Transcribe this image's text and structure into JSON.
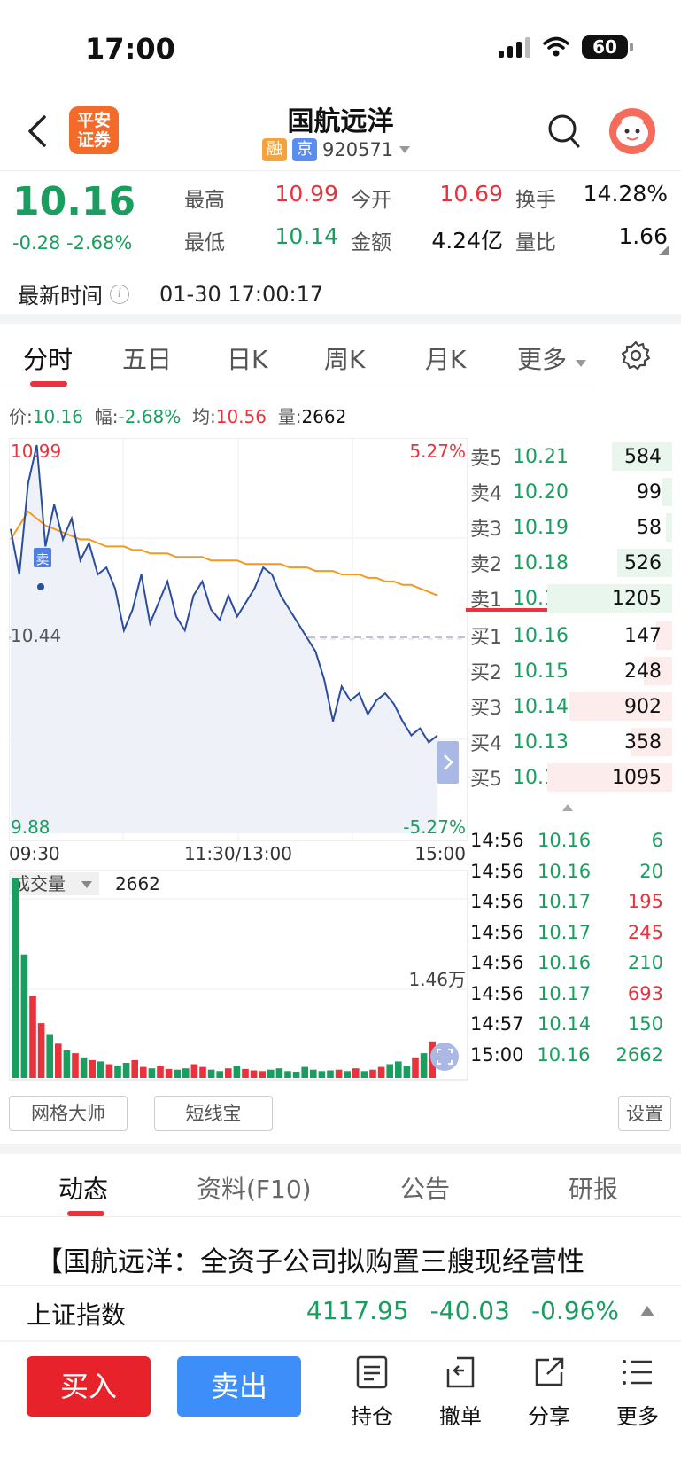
{
  "status": {
    "time": "17:00",
    "battery": "60"
  },
  "header": {
    "logo": "平安证券",
    "title": "国航远洋",
    "tag_rong": "融",
    "tag_jing": "京",
    "code": "920571"
  },
  "quote": {
    "price": "10.16",
    "change": "-0.28",
    "change_pct": "-2.68%",
    "high_label": "最高",
    "high": "10.99",
    "open_label": "今开",
    "open": "10.69",
    "turnover_label": "换手",
    "turnover": "14.28%",
    "low_label": "最低",
    "low": "10.14",
    "amount_label": "金额",
    "amount": "4.24亿",
    "vol_ratio_label": "量比",
    "vol_ratio": "1.66",
    "latest_label": "最新时间",
    "latest_time": "01-30 17:00:17"
  },
  "ktabs": [
    "分时",
    "五日",
    "日K",
    "周K",
    "月K",
    "更多"
  ],
  "pricebar": {
    "price_label": "价:",
    "price": "10.16",
    "range_label": "幅:",
    "range": "-2.68%",
    "avg_label": "均:",
    "avg": "10.56",
    "vol_label": "量:",
    "vol": "2662"
  },
  "chart_data": {
    "type": "line",
    "x_ticks": [
      "09:30",
      "11:30/13:00",
      "15:00"
    ],
    "ylim": [
      9.88,
      10.99
    ],
    "y_ticks": [
      "10.99",
      "10.44",
      "9.88"
    ],
    "right_ticks": [
      "5.27%",
      "-5.27%"
    ],
    "prev_close": 10.44,
    "sell_marker": "卖",
    "series": [
      {
        "values": [
          10.75,
          10.62,
          10.88,
          10.99,
          10.7,
          10.82,
          10.72,
          10.78,
          10.66,
          10.71,
          10.62,
          10.64,
          10.58,
          10.46,
          10.52,
          10.62,
          10.48,
          10.54,
          10.6,
          10.5,
          10.46,
          10.56,
          10.6,
          10.52,
          10.49,
          10.56,
          10.5,
          10.54,
          10.58,
          10.64,
          10.62,
          10.56,
          10.52,
          10.48,
          10.44,
          10.4,
          10.32,
          10.2,
          10.3,
          10.26,
          10.28,
          10.22,
          10.26,
          10.28,
          10.25,
          10.2,
          10.16,
          10.18,
          10.14,
          10.16
        ]
      },
      {
        "values": [
          10.72,
          10.76,
          10.8,
          10.78,
          10.76,
          10.75,
          10.74,
          10.73,
          10.72,
          10.72,
          10.71,
          10.7,
          10.7,
          10.7,
          10.69,
          10.69,
          10.68,
          10.68,
          10.68,
          10.67,
          10.67,
          10.67,
          10.67,
          10.66,
          10.66,
          10.66,
          10.66,
          10.65,
          10.65,
          10.65,
          10.65,
          10.65,
          10.64,
          10.64,
          10.64,
          10.63,
          10.63,
          10.63,
          10.62,
          10.62,
          10.62,
          10.61,
          10.61,
          10.6,
          10.6,
          10.59,
          10.59,
          10.58,
          10.57,
          10.56
        ]
      }
    ],
    "volume_label": "成交量",
    "volume_value": "2662",
    "volume_tick": "1.46万",
    "volume": [
      14600,
      9000,
      6000,
      4000,
      3200,
      2500,
      2000,
      1800,
      1500,
      1300,
      1200,
      1000,
      900,
      1100,
      1300,
      800,
      700,
      900,
      650,
      600,
      700,
      1000,
      800,
      600,
      500,
      700,
      900,
      650,
      550,
      500,
      600,
      700,
      500,
      450,
      800,
      600,
      500,
      550,
      600,
      500,
      700,
      500,
      600,
      800,
      1000,
      1200,
      900,
      1500,
      1800,
      2662
    ]
  },
  "orderbook": {
    "asks": [
      {
        "name": "卖5",
        "price": "10.21",
        "vol": "584",
        "ratio": 0.48
      },
      {
        "name": "卖4",
        "price": "10.20",
        "vol": "99",
        "ratio": 0.08
      },
      {
        "name": "卖3",
        "price": "10.19",
        "vol": "58",
        "ratio": 0.05
      },
      {
        "name": "卖2",
        "price": "10.18",
        "vol": "526",
        "ratio": 0.44
      },
      {
        "name": "卖1",
        "price": "10.17",
        "vol": "1205",
        "ratio": 1.0
      }
    ],
    "bids": [
      {
        "name": "买1",
        "price": "10.16",
        "vol": "147",
        "ratio": 0.13
      },
      {
        "name": "买2",
        "price": "10.15",
        "vol": "248",
        "ratio": 0.23
      },
      {
        "name": "买3",
        "price": "10.14",
        "vol": "902",
        "ratio": 0.82
      },
      {
        "name": "买4",
        "price": "10.13",
        "vol": "358",
        "ratio": 0.33
      },
      {
        "name": "买5",
        "price": "10.12",
        "vol": "1095",
        "ratio": 1.0
      }
    ]
  },
  "ticks": [
    {
      "time": "14:56",
      "price": "10.16",
      "vol": "6",
      "pc": "green",
      "vc": "green"
    },
    {
      "time": "14:56",
      "price": "10.16",
      "vol": "20",
      "pc": "green",
      "vc": "green"
    },
    {
      "time": "14:56",
      "price": "10.17",
      "vol": "195",
      "pc": "green",
      "vc": "red"
    },
    {
      "time": "14:56",
      "price": "10.17",
      "vol": "245",
      "pc": "green",
      "vc": "red"
    },
    {
      "time": "14:56",
      "price": "10.16",
      "vol": "210",
      "pc": "green",
      "vc": "green"
    },
    {
      "time": "14:56",
      "price": "10.17",
      "vol": "693",
      "pc": "green",
      "vc": "red"
    },
    {
      "time": "14:57",
      "price": "10.14",
      "vol": "150",
      "pc": "green",
      "vc": "green"
    },
    {
      "time": "15:00",
      "price": "10.16",
      "vol": "2662",
      "pc": "green",
      "vc": "green"
    }
  ],
  "tools": {
    "grid": "网格大师",
    "short": "短线宝",
    "settings": "设置"
  },
  "ctabs": [
    "动态",
    "资料(F10)",
    "公告",
    "研报"
  ],
  "news": "【国航远洋：全资子公司拟购置三艘现经营性",
  "index": {
    "name": "上证指数",
    "value": "4117.95",
    "change": "-40.03",
    "pct": "-0.96%"
  },
  "bottom": {
    "buy": "买入",
    "sell": "卖出",
    "position": "持仓",
    "cancel": "撤单",
    "share": "分享",
    "more": "更多"
  },
  "colors": {
    "red": "#e8333c",
    "green": "#1a9e5f",
    "price_line": "#2b4da0",
    "avg_line": "#f39a1e"
  }
}
